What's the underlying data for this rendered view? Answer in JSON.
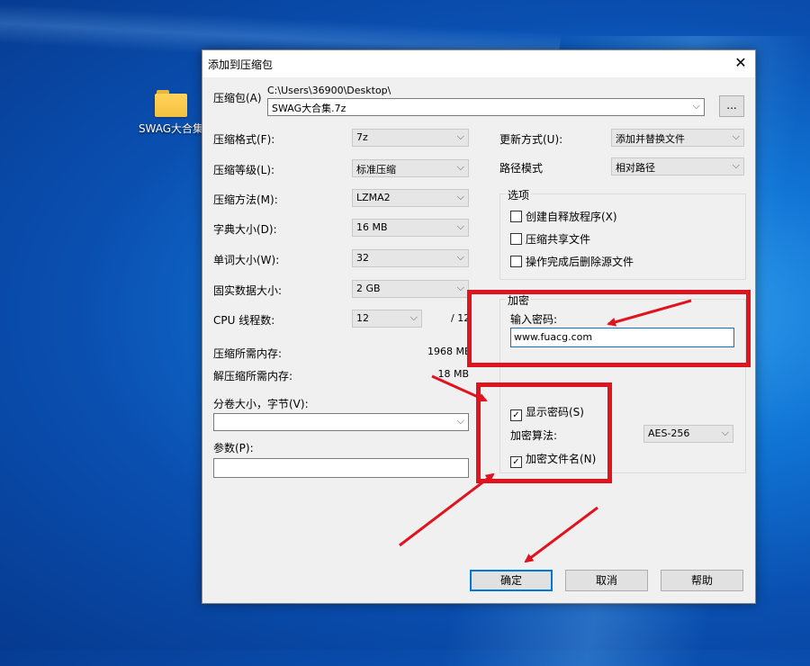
{
  "desktop": {
    "icon_label": "SWAG大合集"
  },
  "dialog": {
    "title": "添加到压缩包",
    "archive": {
      "label": "压缩包(A)",
      "path": "C:\\Users\\36900\\Desktop\\",
      "value": "SWAG大合集.7z",
      "browse_label": "..."
    },
    "left": {
      "format": {
        "label": "压缩格式(F):",
        "value": "7z"
      },
      "level": {
        "label": "压缩等级(L):",
        "value": "标准压缩"
      },
      "method": {
        "label": "压缩方法(M):",
        "value": "LZMA2"
      },
      "dict": {
        "label": "字典大小(D):",
        "value": "16 MB"
      },
      "word": {
        "label": "单词大小(W):",
        "value": "32"
      },
      "solid": {
        "label": "固实数据大小:",
        "value": "2 GB"
      },
      "cpu": {
        "label": "CPU 线程数:",
        "value": "12",
        "suffix": "/ 12"
      },
      "mem_compress": {
        "label": "压缩所需内存:",
        "value": "1968 MB"
      },
      "mem_decompress": {
        "label": "解压缩所需内存:",
        "value": "18 MB"
      },
      "volume": {
        "label": "分卷大小，字节(V):",
        "value": ""
      },
      "params": {
        "label": "参数(P):",
        "value": ""
      }
    },
    "right": {
      "update": {
        "label": "更新方式(U):",
        "value": "添加并替换文件"
      },
      "path_mode": {
        "label": "路径模式",
        "value": "相对路径"
      },
      "options": {
        "title": "选项",
        "items": [
          {
            "label": "创建自释放程序(X)",
            "checked": false
          },
          {
            "label": "压缩共享文件",
            "checked": false
          },
          {
            "label": "操作完成后删除源文件",
            "checked": false
          }
        ]
      },
      "encrypt": {
        "title": "加密",
        "password_label": "输入密码:",
        "password_value": "www.fuacg.com",
        "show_password": {
          "label": "显示密码(S)",
          "checked": true
        },
        "algorithm_label": "加密算法:",
        "algorithm_value": "AES-256",
        "encrypt_names": {
          "label": "加密文件名(N)",
          "checked": true
        }
      }
    },
    "buttons": {
      "ok": "确定",
      "cancel": "取消",
      "help": "帮助"
    }
  },
  "colors": {
    "annotation_red": "#e0141e",
    "accent": "#0078d7"
  }
}
